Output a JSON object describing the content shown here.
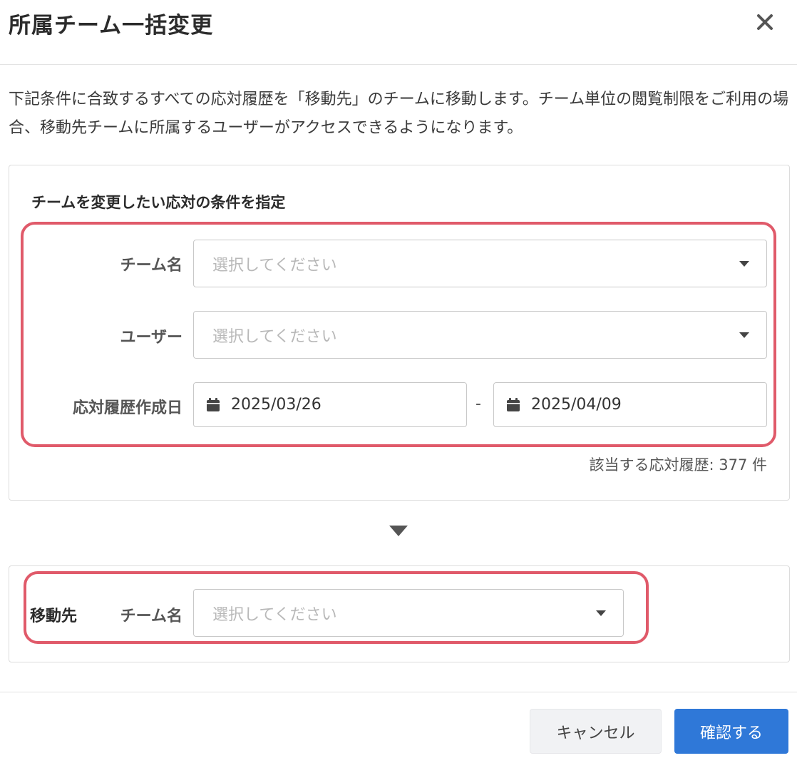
{
  "dialog": {
    "title": "所属チーム一括変更",
    "description": "下記条件に合致するすべての応対履歴を「移動先」のチームに移動します。チーム単位の閲覧制限をご利用の場合、移動先チームに所属するユーザーがアクセスできるようになります。"
  },
  "conditions": {
    "section_title": "チームを変更したい応対の条件を指定",
    "team": {
      "label": "チーム名",
      "placeholder": "選択してください"
    },
    "user": {
      "label": "ユーザー",
      "placeholder": "選択してください"
    },
    "date": {
      "label": "応対履歴作成日",
      "from": "2025/03/26",
      "separator": "-",
      "to": "2025/04/09"
    },
    "count_text": "該当する応対履歴: 377 件"
  },
  "destination": {
    "label": "移動先",
    "team": {
      "label": "チーム名",
      "placeholder": "選択してください"
    }
  },
  "footer": {
    "cancel_label": "キャンセル",
    "confirm_label": "確認する"
  },
  "colors": {
    "highlight": "#e05a6a",
    "primary": "#2f78d8"
  }
}
